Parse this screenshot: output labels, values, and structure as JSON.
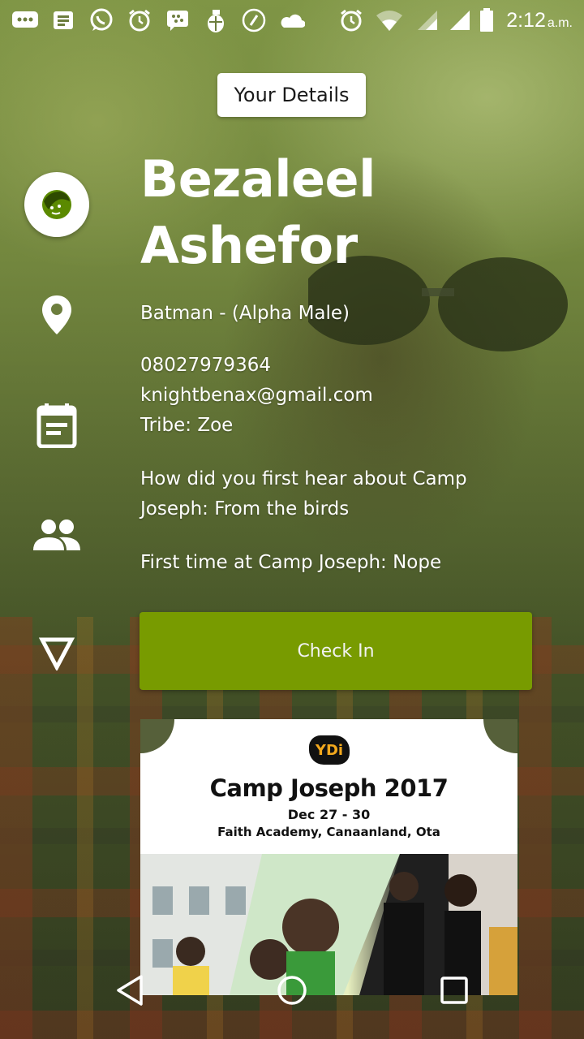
{
  "status_bar": {
    "time": "2:12",
    "ampm": "a.m.",
    "left_icons": [
      "messages-icon",
      "news-icon",
      "whatsapp-icon",
      "alarm-icon",
      "bbm-icon",
      "grenade-icon",
      "music-icon",
      "cloud-icon"
    ],
    "right_icons": [
      "alarm-icon",
      "wifi-icon",
      "signal-icon",
      "signal-icon",
      "battery-icon"
    ]
  },
  "header": {
    "title": "Your Details"
  },
  "rail": {
    "items": [
      "avatar-icon",
      "location-pin-icon",
      "event-note-icon",
      "people-icon",
      "triangle-down-icon"
    ],
    "accent": "#5b8a00"
  },
  "profile": {
    "first_name": "Bezaleel",
    "last_name": "Ashefor",
    "alias": "Batman - (Alpha Male)",
    "phone": "08027979364",
    "email": "knightbenax@gmail.com",
    "tribe": "Tribe: Zoe",
    "heard_about": "How did you first hear about Camp Joseph: From the birds",
    "first_time": "First time at Camp Joseph: Nope"
  },
  "actions": {
    "checkin_label": "Check In",
    "checkin_color": "#789b00"
  },
  "ticket": {
    "logo": "YDi",
    "title": "Camp Joseph 2017",
    "dates": "Dec 27 - 30",
    "venue": "Faith Academy, Canaanland, Ota"
  },
  "navbar": {
    "buttons": [
      "back-icon",
      "home-icon",
      "recents-icon"
    ]
  }
}
